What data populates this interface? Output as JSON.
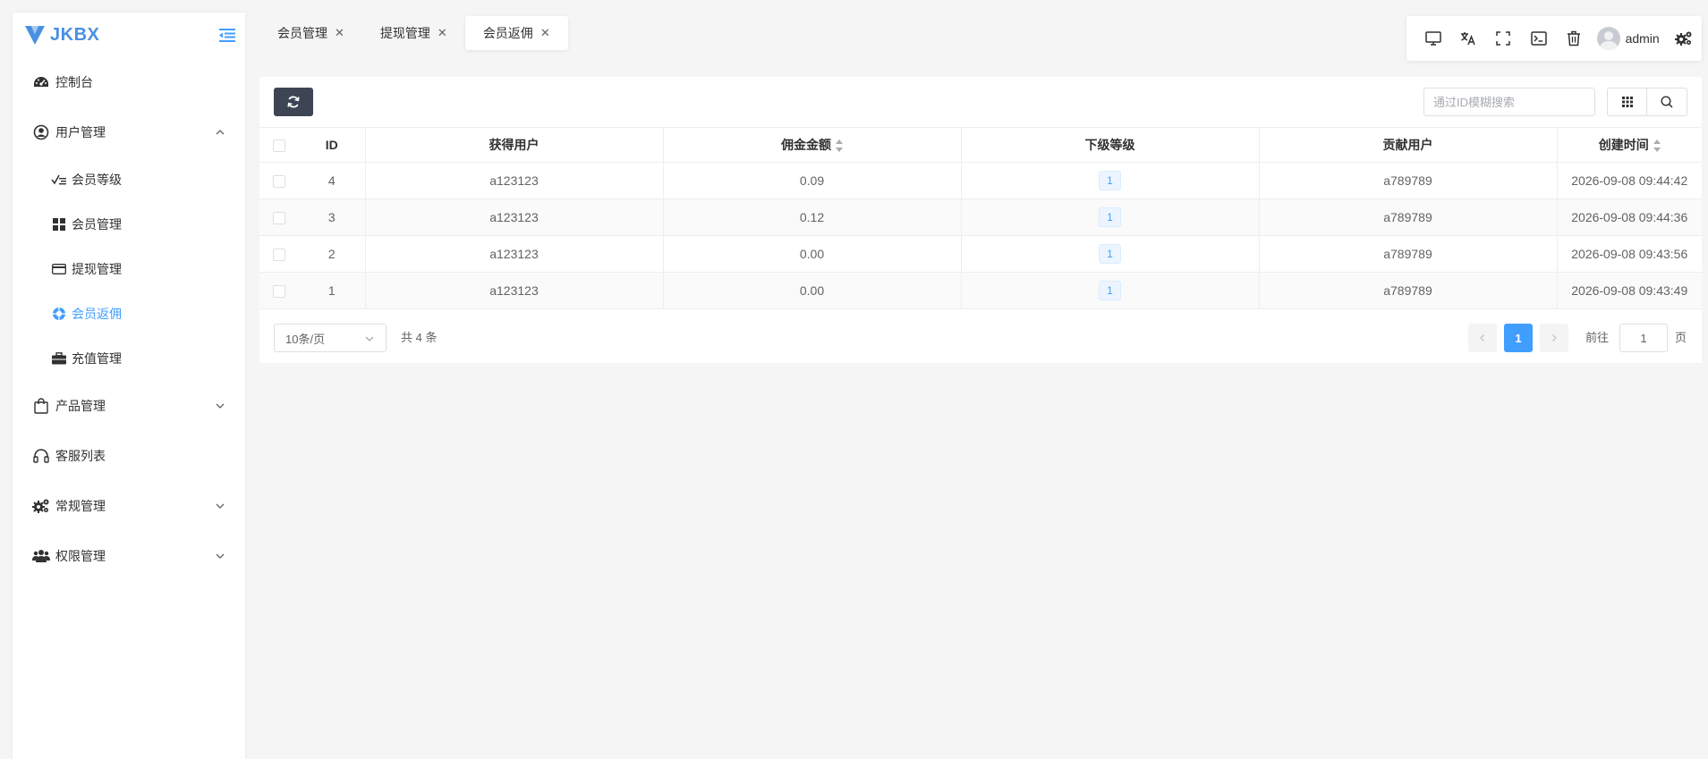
{
  "app": {
    "logo_text": "JKBX",
    "brand_color": "#4a90e2",
    "accent_color": "#409eff"
  },
  "sidebar": {
    "items": [
      {
        "label": "控制台",
        "icon": "dashboard-icon"
      },
      {
        "label": "用户管理",
        "icon": "user-circle-icon",
        "expanded": true,
        "children": [
          {
            "label": "会员等级",
            "icon": "level-icon"
          },
          {
            "label": "会员管理",
            "icon": "grid-icon"
          },
          {
            "label": "提现管理",
            "icon": "credit-card-icon"
          },
          {
            "label": "会员返佣",
            "icon": "commission-icon",
            "active": true
          },
          {
            "label": "充值管理",
            "icon": "briefcase-icon"
          }
        ]
      },
      {
        "label": "产品管理",
        "icon": "shopping-bag-icon"
      },
      {
        "label": "客服列表",
        "icon": "headset-icon"
      },
      {
        "label": "常规管理",
        "icon": "cogs-icon"
      },
      {
        "label": "权限管理",
        "icon": "users-icon"
      }
    ]
  },
  "tabs": [
    {
      "label": "会员管理",
      "active": false
    },
    {
      "label": "提现管理",
      "active": false
    },
    {
      "label": "会员返佣",
      "active": true
    }
  ],
  "toolbar": {
    "username": "admin"
  },
  "search": {
    "placeholder": "通过ID模糊搜索"
  },
  "table": {
    "headers": {
      "id": "ID",
      "user": "获得用户",
      "amount": "佣金金额",
      "level": "下级等级",
      "contributor": "贡献用户",
      "created": "创建时间"
    },
    "rows": [
      {
        "id": "4",
        "user": "a123123",
        "amount": "0.09",
        "level": "1",
        "contributor": "a789789",
        "created": "2026-09-08 09:44:42"
      },
      {
        "id": "3",
        "user": "a123123",
        "amount": "0.12",
        "level": "1",
        "contributor": "a789789",
        "created": "2026-09-08 09:44:36"
      },
      {
        "id": "2",
        "user": "a123123",
        "amount": "0.00",
        "level": "1",
        "contributor": "a789789",
        "created": "2026-09-08 09:43:56"
      },
      {
        "id": "1",
        "user": "a123123",
        "amount": "0.00",
        "level": "1",
        "contributor": "a789789",
        "created": "2026-09-08 09:43:49"
      }
    ]
  },
  "pagination": {
    "page_size": "10条/页",
    "total": "共 4 条",
    "current": "1",
    "goto_label": "前往",
    "jump_value": "1",
    "page_suffix": "页"
  }
}
